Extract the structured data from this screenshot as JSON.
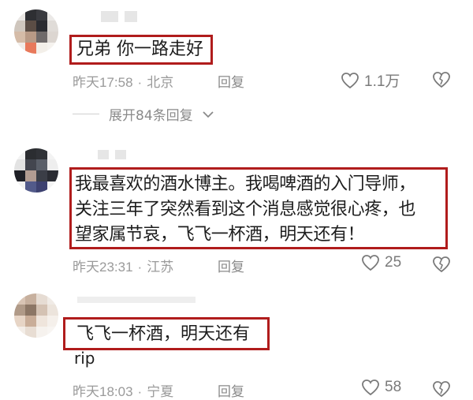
{
  "comments": [
    {
      "text_lines": [
        "兄弟 你一路走好"
      ],
      "time": "昨天17:58",
      "location": "北京",
      "reply_label": "回复",
      "likes": "1.1万",
      "expand_label": "展开84条回复"
    },
    {
      "text_lines": [
        "我最喜欢的酒水博主。我喝啤酒的入门导师，",
        "关注三年了突然看到这个消息感觉很心疼，也",
        "望家属节哀，飞飞一杯酒，明天还有！"
      ],
      "time": "昨天23:31",
      "location": "江苏",
      "reply_label": "回复",
      "likes": "25"
    },
    {
      "text_lines": [
        "飞飞一杯酒，明天还有"
      ],
      "extra_text": "rip",
      "time": "昨天18:03",
      "location": "宁夏",
      "reply_label": "回复",
      "likes": "58"
    }
  ],
  "colors": {
    "highlight_border": "#b01c1c",
    "meta_text": "#9a9a9a"
  },
  "icons": [
    "heart-outline-icon",
    "broken-heart-icon",
    "chevron-down-icon"
  ]
}
